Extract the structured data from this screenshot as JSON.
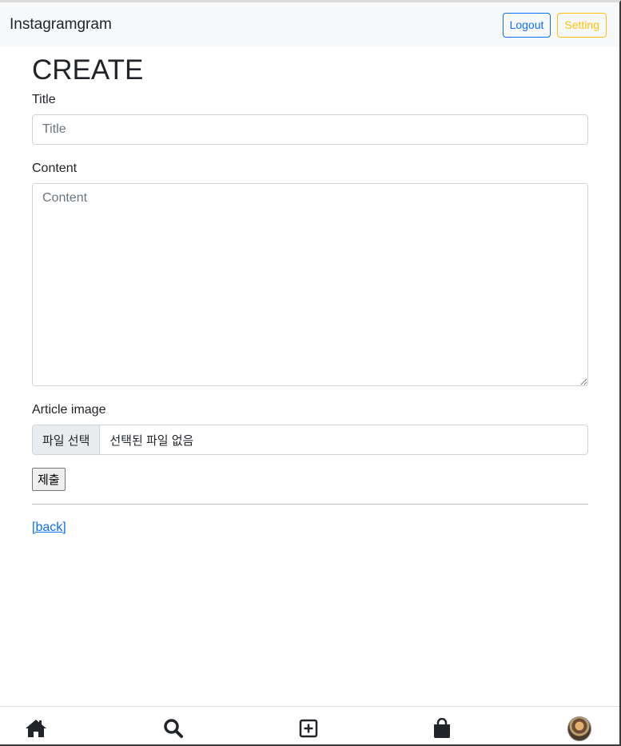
{
  "navbar": {
    "brand": "Instagramgram",
    "logout_label": "Logout",
    "setting_label": "Setting"
  },
  "page": {
    "title": "CREATE"
  },
  "form": {
    "title_label": "Title",
    "title_placeholder": "Title",
    "title_value": "",
    "content_label": "Content",
    "content_placeholder": "Content",
    "content_value": "",
    "image_label": "Article image",
    "file_button_label": "파일 선택",
    "file_status": "선택된 파일 없음",
    "submit_label": "제출"
  },
  "back_link": "[back]",
  "bottom_nav": {
    "items": [
      {
        "name": "home-icon"
      },
      {
        "name": "search-icon"
      },
      {
        "name": "plus-square-icon"
      },
      {
        "name": "shopping-bag-icon"
      },
      {
        "name": "avatar"
      }
    ]
  },
  "colors": {
    "primary": "#0d6efd",
    "warning": "#ffc107",
    "navbar_bg": "#f8f9fa",
    "text": "#212529"
  }
}
